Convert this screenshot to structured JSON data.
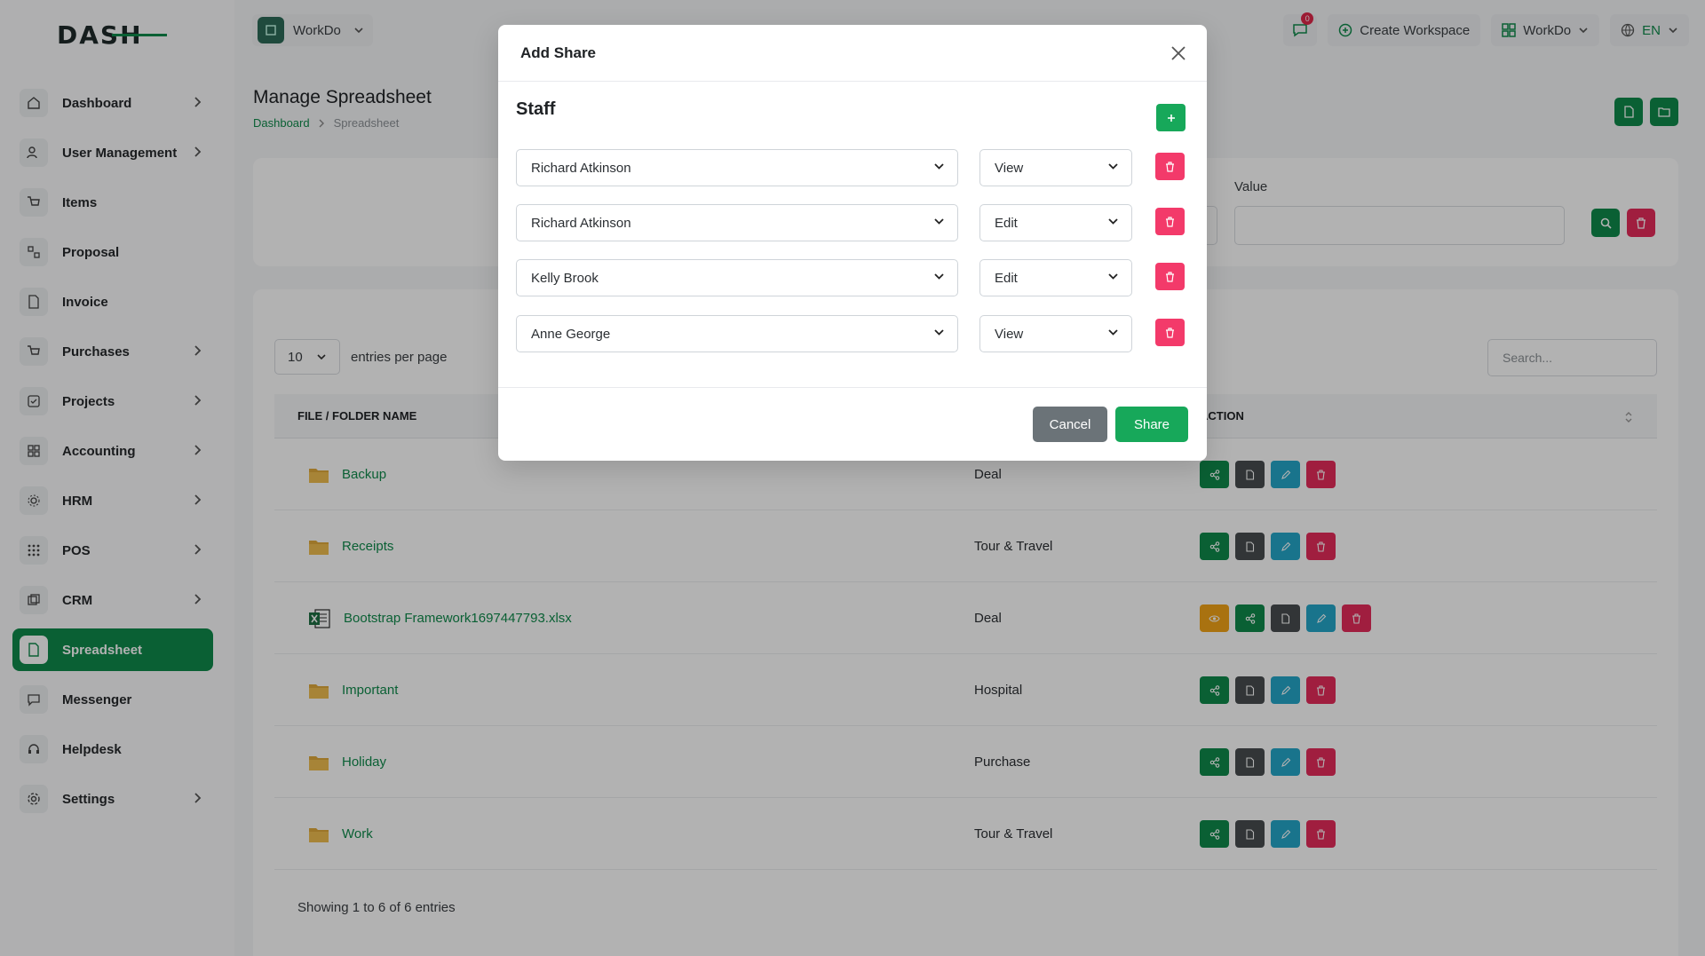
{
  "brand": {
    "logo_text": "DASH"
  },
  "topbar": {
    "workspace": "WorkDo",
    "message_count": "0",
    "create_workspace": "Create Workspace",
    "workspace_switch": "WorkDo",
    "language": "EN"
  },
  "sidebar": {
    "items": [
      {
        "label": "Dashboard"
      },
      {
        "label": "User Management"
      },
      {
        "label": "Items"
      },
      {
        "label": "Proposal"
      },
      {
        "label": "Invoice"
      },
      {
        "label": "Purchases"
      },
      {
        "label": "Projects"
      },
      {
        "label": "Accounting"
      },
      {
        "label": "HRM"
      },
      {
        "label": "POS"
      },
      {
        "label": "CRM"
      },
      {
        "label": "Spreadsheet"
      },
      {
        "label": "Messenger"
      },
      {
        "label": "Helpdesk"
      },
      {
        "label": "Settings"
      }
    ]
  },
  "page": {
    "title": "Manage Spreadsheet",
    "breadcrumb": {
      "home": "Dashboard",
      "current": "Spreadsheet"
    }
  },
  "filter": {
    "value_label": "Value"
  },
  "table": {
    "entries_value": "10",
    "entries_label": "entries per page",
    "search_placeholder": "Search...",
    "headers": {
      "name": "File / Folder Name",
      "action": "Action"
    },
    "rows": [
      {
        "name": "Backup",
        "type": "Deal",
        "kind": "folder"
      },
      {
        "name": "Receipts",
        "type": "Tour & Travel",
        "kind": "folder"
      },
      {
        "name": "Bootstrap Framework1697447793.xlsx",
        "type": "Deal",
        "kind": "file"
      },
      {
        "name": "Important",
        "type": "Hospital",
        "kind": "folder"
      },
      {
        "name": "Holiday",
        "type": "Purchase",
        "kind": "folder"
      },
      {
        "name": "Work",
        "type": "Tour & Travel",
        "kind": "folder"
      }
    ],
    "showing": "Showing 1 to 6 of 6 entries"
  },
  "modal": {
    "title": "Add Share",
    "section": "Staff",
    "shares": [
      {
        "staff": "Richard Atkinson",
        "permission": "View"
      },
      {
        "staff": "Richard Atkinson",
        "permission": "Edit"
      },
      {
        "staff": "Kelly Brook",
        "permission": "Edit"
      },
      {
        "staff": "Anne George",
        "permission": "View"
      }
    ],
    "cancel": "Cancel",
    "share": "Share"
  },
  "colors": {
    "primary": "#0f8a4b",
    "danger": "#e62b5b",
    "info": "#24a7c9",
    "warning": "#f3a418"
  }
}
